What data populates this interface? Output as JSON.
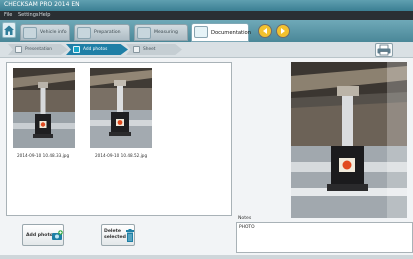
{
  "window": {
    "title": "CHECKSAM PRO 2014 EN"
  },
  "menu": {
    "items": [
      "File",
      "Settings",
      "Help"
    ]
  },
  "tabs": [
    {
      "label": "Vehicle info"
    },
    {
      "label": "Preparation"
    },
    {
      "label": "Measuring"
    },
    {
      "label": "Documentation"
    }
  ],
  "steps": [
    {
      "label": "Presentation"
    },
    {
      "label": "Add photos"
    },
    {
      "label": "Sheet"
    }
  ],
  "gallery": {
    "photos": [
      {
        "filename": "2014-09-10 10.48.33.jpg"
      },
      {
        "filename": "2014-09-10 10.48.52.jpg"
      }
    ]
  },
  "notes": {
    "label": "Notes",
    "text": "PHOTO"
  },
  "actions": {
    "add_photo": "Add photo",
    "delete_line1": "Delete",
    "delete_line2": "selected"
  },
  "colors": {
    "accent": "#1f7fa6",
    "titlebar": "#3b7f93",
    "nav_button": "#f2c12e"
  }
}
